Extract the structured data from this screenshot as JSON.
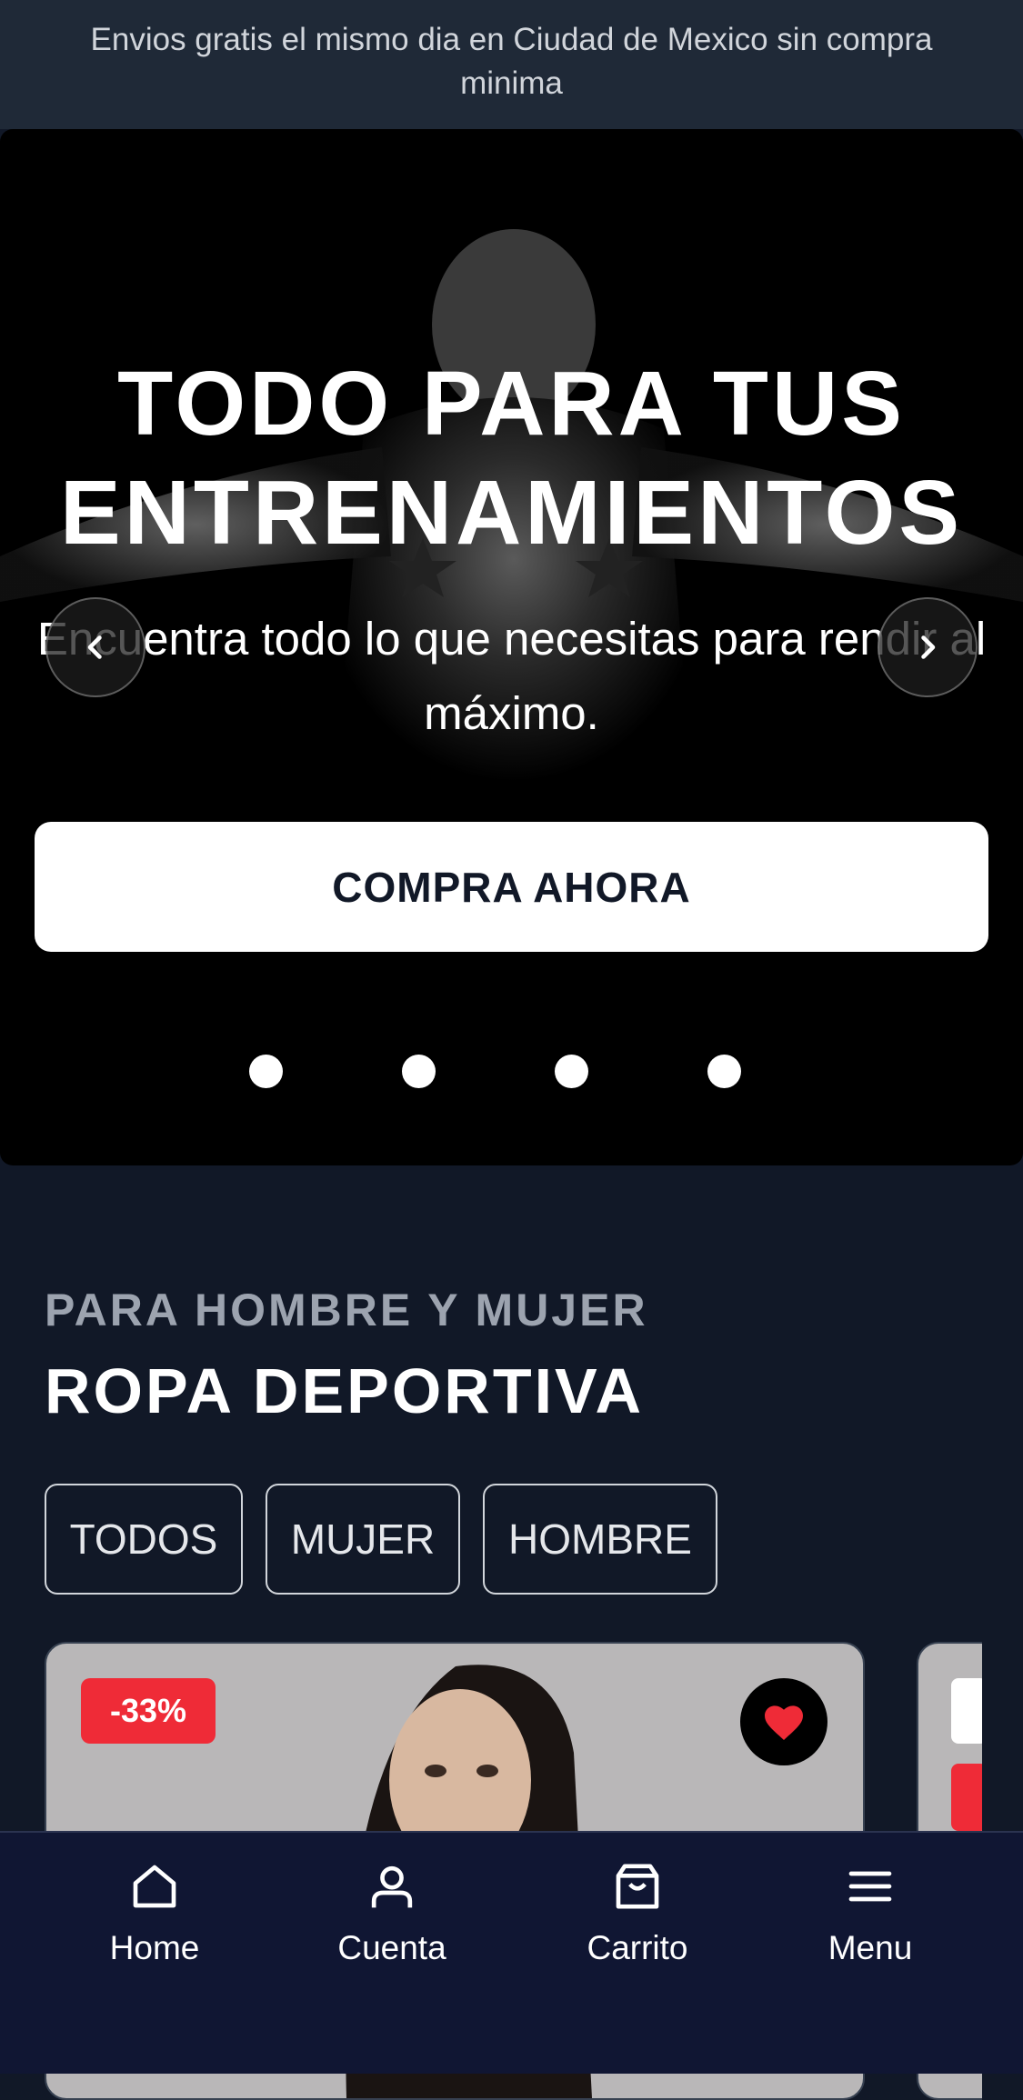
{
  "announcement": "Envios gratis el mismo dia en Ciudad de Mexico sin compra minima",
  "hero": {
    "title_line1": "TODO PARA TUS",
    "title_line2": "ENTRENAMIENTOS",
    "subtitle": "Encuentra todo lo que necesitas para rendir al máximo.",
    "cta_label": "COMPRA AHORA",
    "prev_icon": "chevron-left-icon",
    "next_icon": "chevron-right-icon",
    "slide_count": 4
  },
  "section": {
    "eyebrow": "PARA HOMBRE Y MUJER",
    "title": "ROPA DEPORTIVA",
    "filters": [
      "TODOS",
      "MUJER",
      "HOMBRE"
    ]
  },
  "products": [
    {
      "discount_badge": "-33%",
      "favorite_icon": "heart-icon",
      "favorited": true
    }
  ],
  "bottom_nav": {
    "items": [
      {
        "label": "Home",
        "icon": "home-icon"
      },
      {
        "label": "Cuenta",
        "icon": "user-icon"
      },
      {
        "label": "Carrito",
        "icon": "shopping-bag-icon"
      },
      {
        "label": "Menu",
        "icon": "menu-icon"
      }
    ]
  },
  "colors": {
    "background": "#111827",
    "topbar": "#1f2937",
    "bottom_nav": "#101633",
    "badge": "#ef2b37",
    "heart": "#ef2b37"
  }
}
